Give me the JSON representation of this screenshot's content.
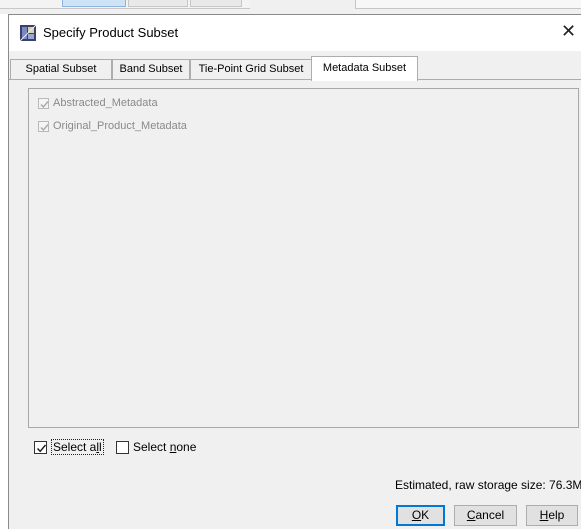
{
  "dialog": {
    "title": "Specify Product Subset",
    "close_glyph": "✕"
  },
  "tabs": [
    {
      "label": "Spatial Subset",
      "active": false
    },
    {
      "label": "Band Subset",
      "active": false
    },
    {
      "label": "Tie-Point Grid Subset",
      "active": false
    },
    {
      "label": "Metadata Subset",
      "active": true
    }
  ],
  "metadata_items": [
    {
      "label": "Abstracted_Metadata",
      "checked": true,
      "enabled": false
    },
    {
      "label": "Original_Product_Metadata",
      "checked": true,
      "enabled": false
    }
  ],
  "select_all": {
    "prefix": "Select a",
    "mnemonic": "l",
    "suffix": "l",
    "checked": true
  },
  "select_none": {
    "prefix": "Select ",
    "mnemonic": "n",
    "suffix": "one",
    "checked": false
  },
  "estimate_text": "Estimated, raw storage size: 76.3M",
  "buttons": {
    "ok": {
      "mnemonic": "O",
      "rest": "K"
    },
    "cancel": {
      "mnemonic": "C",
      "rest": "ancel"
    },
    "help": {
      "mnemonic": "H",
      "rest": "elp"
    }
  },
  "icons": {
    "app": "product-subset-icon",
    "close": "close-icon",
    "check": "check-icon"
  }
}
